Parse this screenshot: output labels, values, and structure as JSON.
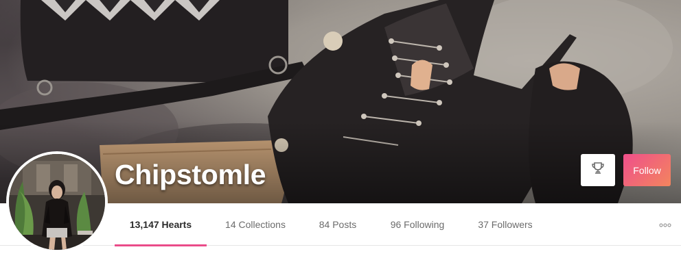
{
  "profile": {
    "name": "Chipstomle",
    "follow_label": "Follow",
    "award_icon": "trophy-icon",
    "more_icon": "more-dots-icon"
  },
  "stats": [
    {
      "label": "13,147 Hearts",
      "active": true
    },
    {
      "label": "14 Collections",
      "active": false
    },
    {
      "label": "84 Posts",
      "active": false
    },
    {
      "label": "96 Following",
      "active": false
    },
    {
      "label": "37 Followers",
      "active": false
    }
  ],
  "colors": {
    "accent": "#ea4c89",
    "follow_gradient_start": "#ef4f8b",
    "follow_gradient_end": "#f3855e"
  }
}
